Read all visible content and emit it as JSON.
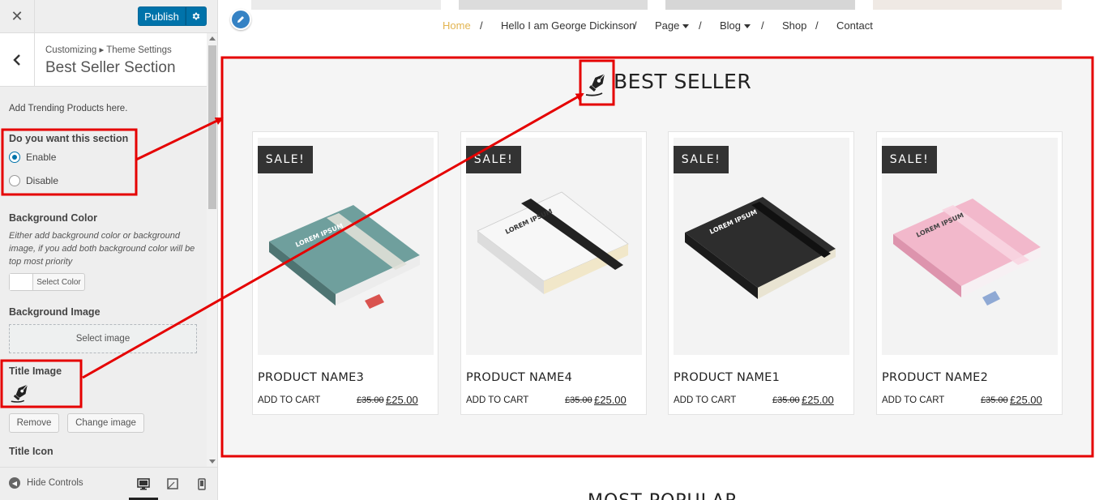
{
  "customizer": {
    "close_icon": "close-icon",
    "publish_label": "Publish",
    "settings_icon": "gear-icon",
    "breadcrumb": "Customizing ▸ Theme Settings",
    "section_title": "Best Seller Section",
    "description": "Add Trending Products here.",
    "toggle": {
      "label": "Do you want this section",
      "options": [
        "Enable",
        "Disable"
      ],
      "selected": "Enable"
    },
    "bg_color": {
      "label": "Background Color",
      "help": "Either add background color or background image, if you add both background color will be top most priority",
      "button": "Select Color"
    },
    "bg_image": {
      "label": "Background Image",
      "button": "Select image"
    },
    "title_image": {
      "label": "Title Image",
      "remove": "Remove",
      "change": "Change image"
    },
    "title_icon_label": "Title Icon",
    "footer": {
      "hide_controls": "Hide Controls",
      "devices": [
        "desktop-icon",
        "tablet-icon",
        "mobile-icon"
      ],
      "active_device": "desktop-icon"
    }
  },
  "preview": {
    "nav": {
      "items": [
        "Home",
        "Hello I am George Dickinson",
        "Page",
        "Blog",
        "Shop",
        "Contact"
      ],
      "separator": "/",
      "active": "Home"
    },
    "section": {
      "title": "BEST SELLER",
      "products": [
        {
          "sale": "SALE!",
          "name": "PRODUCT NAME3",
          "cart": "ADD TO CART",
          "old_price": "£35.00",
          "price": "£25.00",
          "book_color": "#6f9f9d",
          "book_text": "LOREM IPSUM"
        },
        {
          "sale": "SALE!",
          "name": "PRODUCT NAME4",
          "cart": "ADD TO CART",
          "old_price": "£35.00",
          "price": "£25.00",
          "book_color": "#f4f4f4",
          "book_text": "LOREM IPSUM"
        },
        {
          "sale": "SALE!",
          "name": "PRODUCT NAME1",
          "cart": "ADD TO CART",
          "old_price": "£35.00",
          "price": "£25.00",
          "book_color": "#2d2d2d",
          "book_text": "LOREM IPSUM"
        },
        {
          "sale": "SALE!",
          "name": "PRODUCT NAME2",
          "cart": "ADD TO CART",
          "old_price": "£35.00",
          "price": "£25.00",
          "book_color": "#f2b8cb",
          "book_text": "LOREM IPSUM"
        }
      ]
    },
    "next_section_title": "MOST POPULAR"
  },
  "colors": {
    "publish": "#0073aa",
    "home_link": "#e2b450",
    "annotation": "#e50000"
  }
}
